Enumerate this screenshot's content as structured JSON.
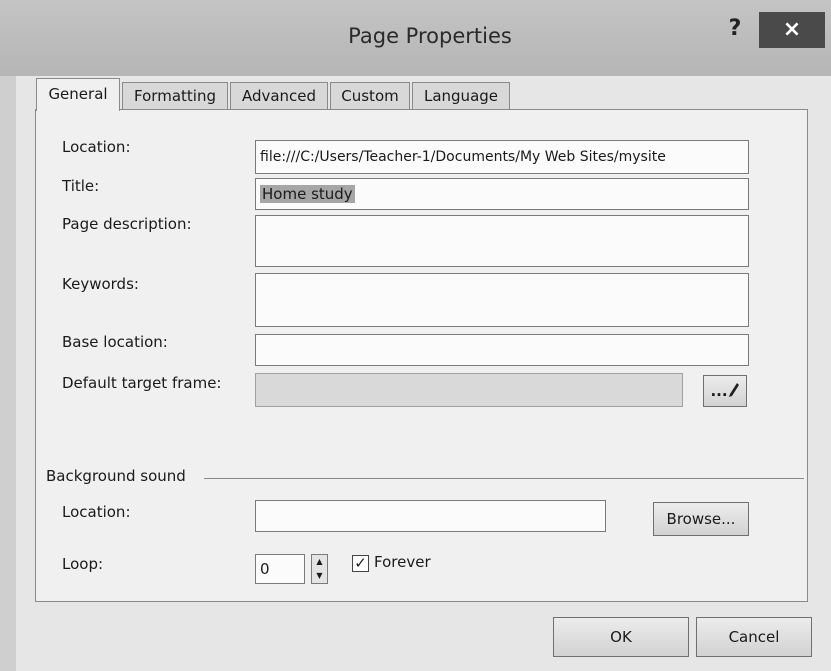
{
  "window": {
    "title": "Page Properties",
    "help_label": "?",
    "close_label": "×"
  },
  "tabs": [
    {
      "label": "General",
      "active": true
    },
    {
      "label": "Formatting",
      "active": false
    },
    {
      "label": "Advanced",
      "active": false
    },
    {
      "label": "Custom",
      "active": false
    },
    {
      "label": "Language",
      "active": false
    }
  ],
  "general": {
    "location_label": "Location:",
    "location_value": "file:///C:/Users/Teacher-1/Documents/My Web Sites/mysite",
    "title_label": "Title:",
    "title_value": "Home study",
    "description_label": "Page description:",
    "description_value": "",
    "keywords_label": "Keywords:",
    "keywords_value": "",
    "base_location_label": "Base location:",
    "base_location_value": "",
    "target_frame_label": "Default target frame:",
    "target_frame_value": "",
    "target_frame_button": "...",
    "target_frame_button_icon": "pencil-icon"
  },
  "background_sound": {
    "section_label": "Background sound",
    "location_label": "Location:",
    "location_value": "",
    "browse_button": "Browse...",
    "loop_label": "Loop:",
    "loop_value": "0",
    "forever_label": "Forever",
    "forever_checked": true
  },
  "footer": {
    "ok_button": "OK",
    "cancel_button": "Cancel"
  }
}
